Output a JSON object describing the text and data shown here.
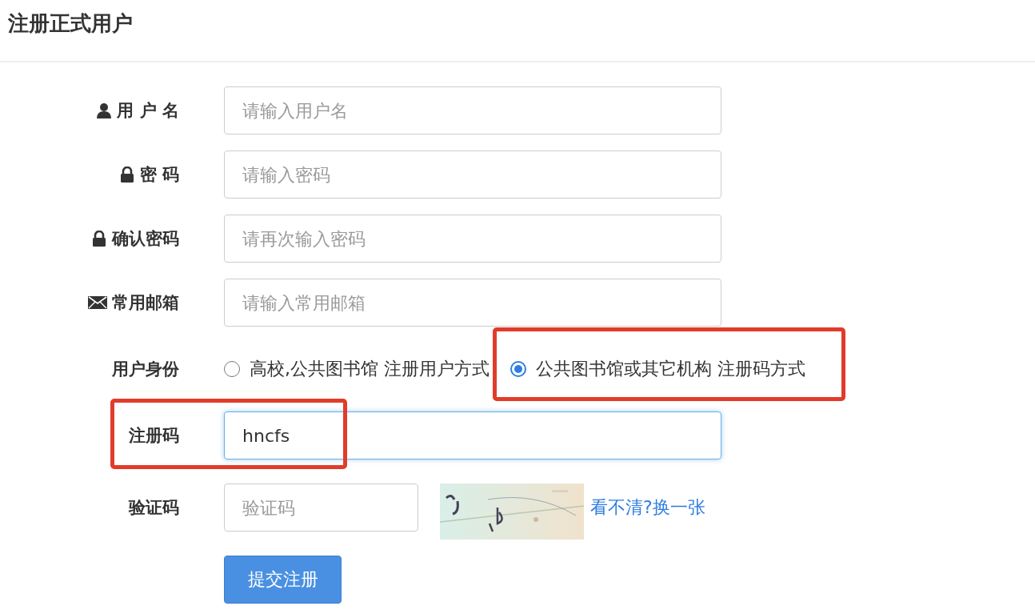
{
  "page": {
    "title": "注册正式用户"
  },
  "form": {
    "rows": [
      {
        "kind": "input",
        "label": "用 户 名",
        "placeholder": "请输入用户名"
      },
      {
        "kind": "input",
        "label": "密 码",
        "placeholder": "请输入密码"
      },
      {
        "kind": "input",
        "label": "确认密码",
        "placeholder": "请再次输入密码"
      },
      {
        "kind": "input",
        "label": "常用邮箱",
        "placeholder": "请输入常用邮箱"
      },
      {
        "kind": "radio",
        "label": "用户身份",
        "options": [
          {
            "label": "高校,公共图书馆 注册用户方式",
            "selected": false,
            "highlighted": false
          },
          {
            "label": "公共图书馆或其它机构 注册码方式",
            "selected": true,
            "highlighted": true
          }
        ]
      },
      {
        "kind": "input",
        "label": "注册码",
        "value": "hncfs",
        "focused": true,
        "highlighted": true
      },
      {
        "kind": "captcha",
        "label": "验证码",
        "placeholder": "验证码",
        "link": "看不清?换一张"
      }
    ],
    "submit": "提交注册"
  }
}
